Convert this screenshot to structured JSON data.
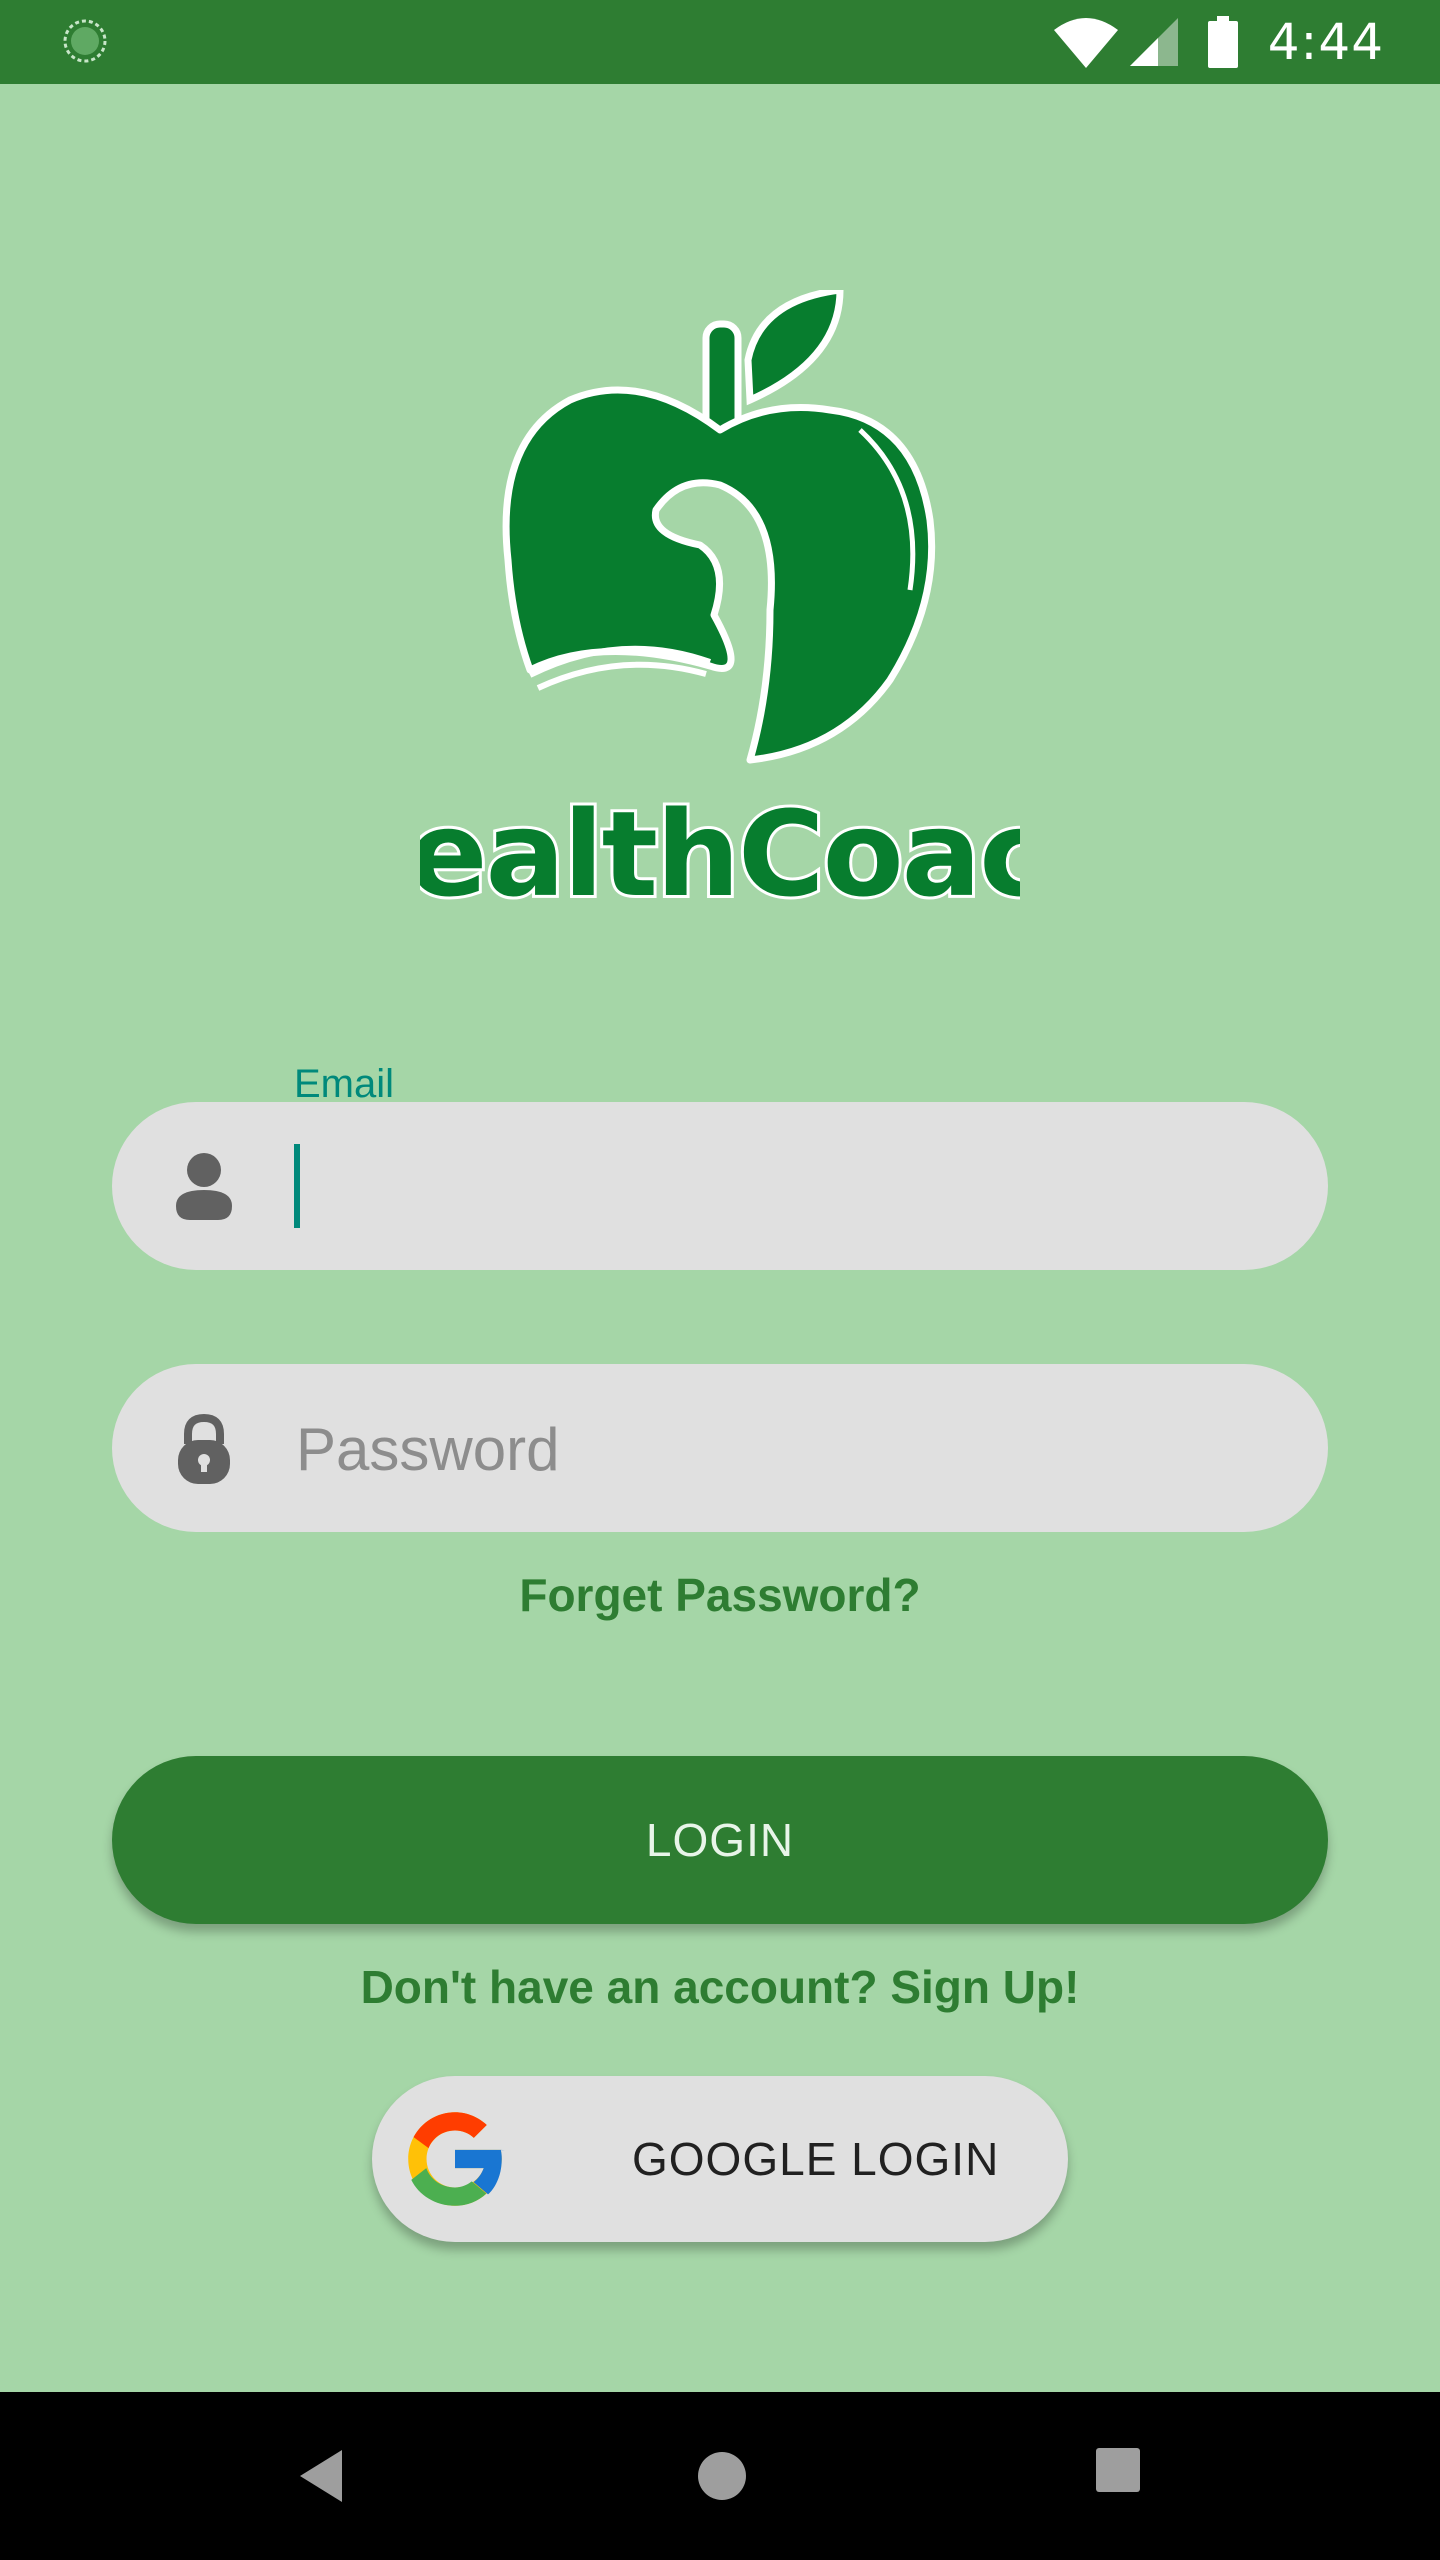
{
  "status_bar": {
    "time": "4:44",
    "left_icon": "loading-circle-icon",
    "right_icons": [
      "wifi-icon",
      "signal-icon",
      "battery-icon"
    ],
    "color": "#2e7d32"
  },
  "logo": {
    "text": "HealthCoach",
    "icon": "apple-logo-icon",
    "color": "#077d2e"
  },
  "email": {
    "label": "Email",
    "value": "",
    "icon": "person-icon"
  },
  "password": {
    "placeholder": "Password",
    "icon": "lock-icon"
  },
  "links": {
    "forget_password": "Forget Password?",
    "signup": "Don't have an account? Sign Up!"
  },
  "buttons": {
    "login": "LOGIN",
    "google_login": "GOOGLE LOGIN"
  },
  "colors": {
    "background": "#a5d6a7",
    "primary": "#2e7d32",
    "field": "#e0e0e0",
    "accent": "#00897b"
  },
  "nav_bar": {
    "icons": [
      "back-icon",
      "home-icon",
      "recents-icon"
    ]
  }
}
